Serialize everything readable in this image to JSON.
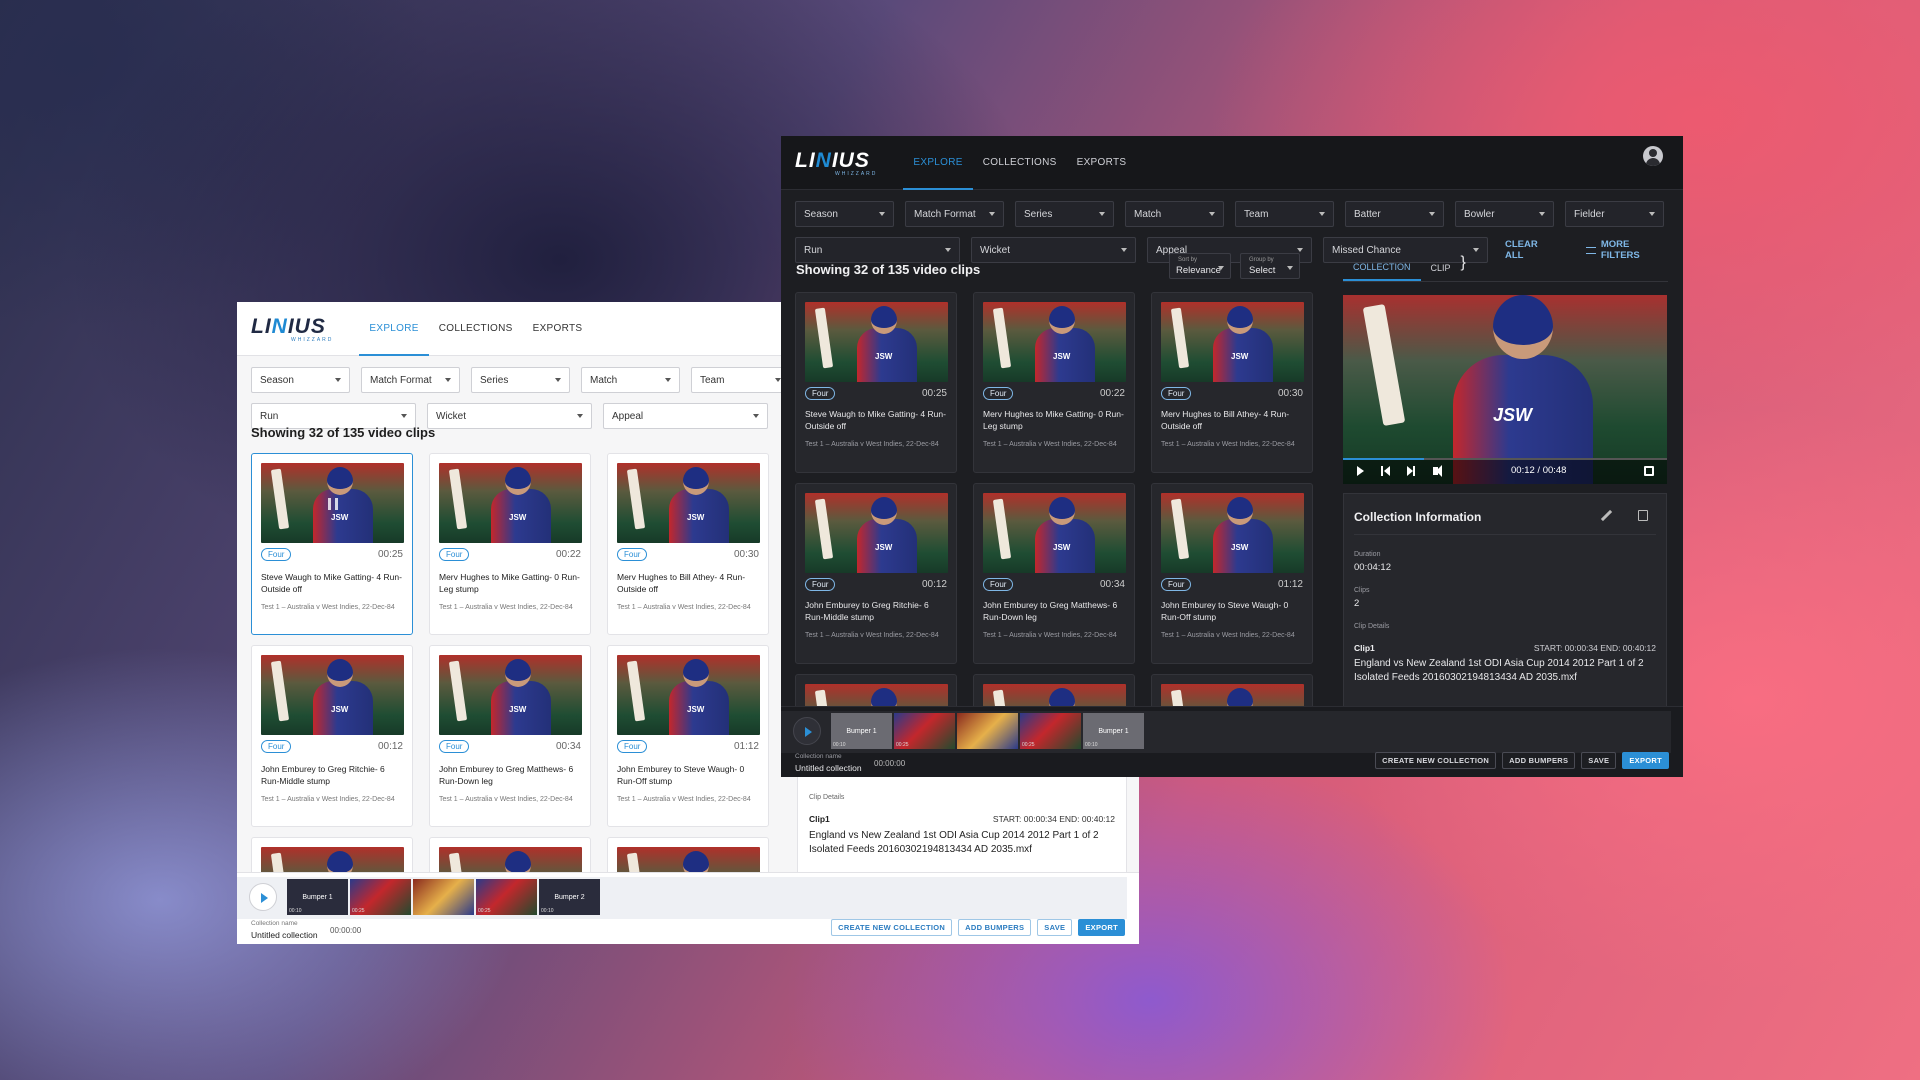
{
  "brand": {
    "logo_text": "LINIUS",
    "logo_sub": "WHIZZARD"
  },
  "nav": {
    "tabs": [
      "EXPLORE",
      "COLLECTIONS",
      "EXPORTS"
    ]
  },
  "filters": {
    "row1": [
      "Season",
      "Match Format",
      "Series",
      "Match",
      "Team",
      "Batter",
      "Bowler",
      "Fielder"
    ],
    "row2": [
      "Run",
      "Wicket",
      "Appeal",
      "Missed Chance"
    ],
    "clear_all": "CLEAR ALL",
    "more_filters": "MORE FILTERS"
  },
  "results": {
    "showing": "Showing 32 of 135 video clips"
  },
  "sort": {
    "sort_label": "Sort by",
    "sort_value": "Relevance",
    "group_label": "Group by",
    "group_value": "Select"
  },
  "clips": [
    {
      "badge": "Four",
      "duration": "00:25",
      "title": "Steve Waugh to Mike Gatting- 4 Run-Outside off",
      "sub": "Test 1 – Australia v West Indies, 22-Dec-84"
    },
    {
      "badge": "Four",
      "duration": "00:22",
      "title": "Merv Hughes to Mike Gatting- 0 Run-Leg stump",
      "sub": "Test 1 – Australia v West Indies, 22-Dec-84"
    },
    {
      "badge": "Four",
      "duration": "00:30",
      "title": "Merv Hughes to Bill Athey- 4 Run-Outside off",
      "sub": "Test 1 – Australia v West Indies, 22-Dec-84"
    },
    {
      "badge": "Four",
      "duration": "00:12",
      "title": "John Emburey to Greg Ritchie- 6 Run-Middle stump",
      "sub": "Test 1 – Australia v West Indies, 22-Dec-84"
    },
    {
      "badge": "Four",
      "duration": "00:34",
      "title": "John Emburey to Greg Matthews- 6 Run-Down leg",
      "sub": "Test 1 – Australia v West Indies, 22-Dec-84"
    },
    {
      "badge": "Four",
      "duration": "01:12",
      "title": "John Emburey to Steve Waugh- 0 Run-Off stump",
      "sub": "Test 1 – Australia v West Indies, 22-Dec-84"
    }
  ],
  "timeline": {
    "segments": [
      {
        "label": "Bumper 1",
        "time": "00:10"
      },
      {
        "label": "",
        "time": "00:25"
      },
      {
        "label": "",
        "time": ""
      },
      {
        "label": "",
        "time": "00:25"
      },
      {
        "label": "Bumper 2",
        "time": "00:10"
      }
    ],
    "collection_label": "Collection name",
    "collection_value": "Untitled collection",
    "total_time": "00:00:00"
  },
  "actions": {
    "create": "CREATE NEW COLLECTION",
    "bumpers": "ADD BUMPERS",
    "save": "SAVE",
    "export": "EXPORT"
  },
  "panel": {
    "tabs": [
      "COLLECTION",
      "CLIP"
    ],
    "player_time": "00:12 / 00:48",
    "player_progress": 0.25,
    "info_title": "Collection Information",
    "duration_label": "Duration",
    "duration_value": "00:04:12",
    "clips_label": "Clips",
    "clips_value": "2",
    "details_label": "Clip Details",
    "clip_name": "Clip1",
    "clip_times": "START: 00:00:34   END: 00:40:12",
    "clip_desc": "England vs New Zealand 1st ODI Asia Cup 2014 2012 Part 1 of 2 Isolated Feeds 20160302194813434 AD 2035.mxf"
  },
  "colors": {
    "accent": "#2b8fd6",
    "dark_bg": "#1d1e22",
    "light_bg": "#f6f6f7"
  }
}
